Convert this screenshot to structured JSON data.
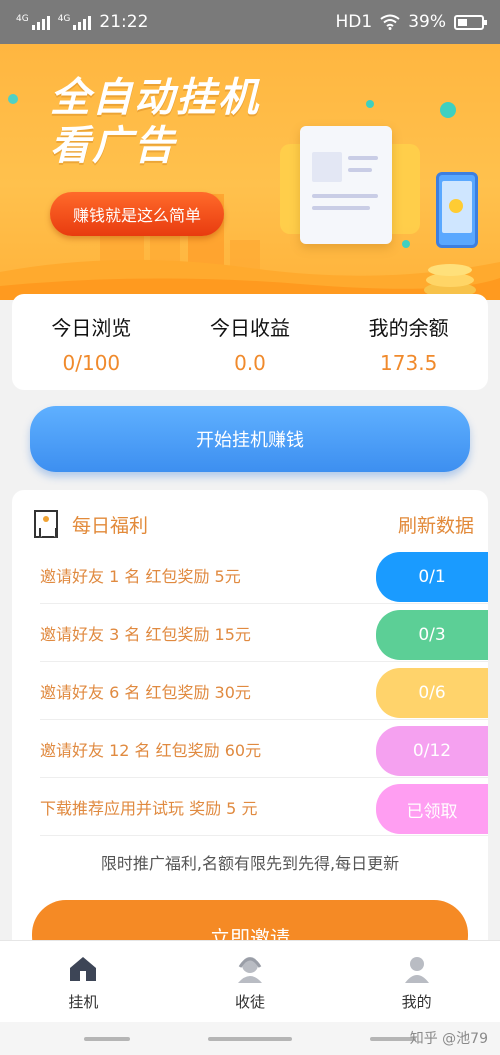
{
  "status_bar": {
    "signal1_label": "4G",
    "signal2_label": "4G",
    "time": "21:22",
    "hd_label": "HD1",
    "battery_percent": "39%"
  },
  "banner": {
    "title_line1": "全自动挂机",
    "title_line2": "看广告",
    "button_label": "赚钱就是这么简单"
  },
  "stats": [
    {
      "label": "今日浏览",
      "value": "0/100"
    },
    {
      "label": "今日收益",
      "value": "0.0"
    },
    {
      "label": "我的余额",
      "value": "173.5"
    }
  ],
  "start_button": "开始挂机赚钱",
  "welfare": {
    "title": "每日福利",
    "refresh": "刷新数据",
    "tasks": [
      {
        "label": "邀请好友 1 名 红包奖励 5元",
        "status": "0/1",
        "color": "#1a9bff"
      },
      {
        "label": "邀请好友 3 名 红包奖励 15元",
        "status": "0/3",
        "color": "#5ccf96"
      },
      {
        "label": "邀请好友 6 名 红包奖励 30元",
        "status": "0/6",
        "color": "#ffd36b"
      },
      {
        "label": "邀请好友 12 名 红包奖励 60元",
        "status": "0/12",
        "color": "#f5a1f0"
      },
      {
        "label": "下载推荐应用并试玩 奖励 5 元",
        "status": "已领取",
        "color": "#ff9ef2"
      }
    ],
    "tip": "限时推广福利,名额有限先到先得,每日更新"
  },
  "invite_button": "立即邀请",
  "tabs": [
    {
      "label": "挂机",
      "icon": "home-icon"
    },
    {
      "label": "收徒",
      "icon": "apprentice-icon"
    },
    {
      "label": "我的",
      "icon": "profile-icon"
    }
  ],
  "watermark": "知乎 @池79"
}
